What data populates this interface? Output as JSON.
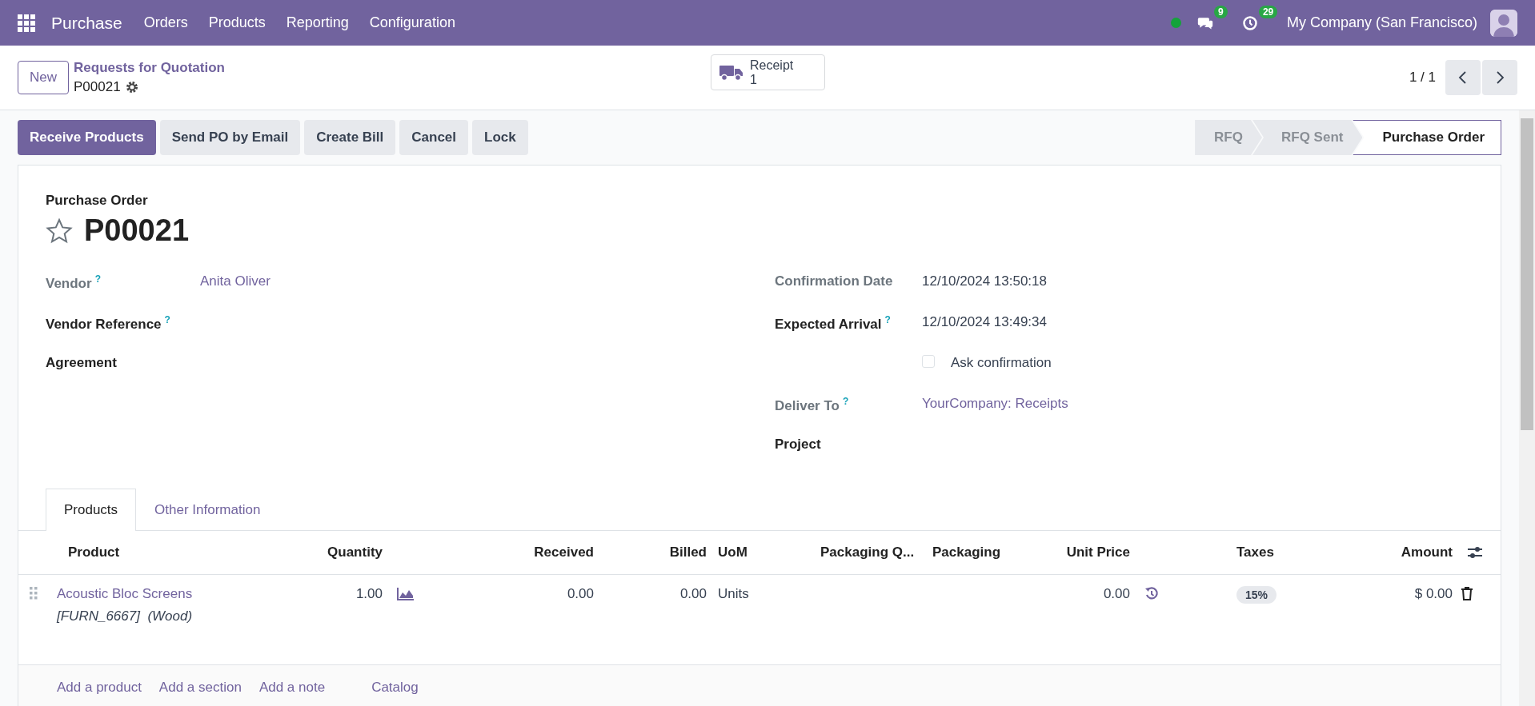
{
  "navbar": {
    "app": "Purchase",
    "menu": [
      "Orders",
      "Products",
      "Reporting",
      "Configuration"
    ],
    "messages_badge": "9",
    "activities_badge": "29",
    "company": "My Company (San Francisco)"
  },
  "control_panel": {
    "new_button": "New",
    "breadcrumb": "Requests for Quotation",
    "record": "P00021",
    "smart_button": {
      "label": "Receipt",
      "count": "1"
    },
    "pager": "1 / 1"
  },
  "actions": [
    {
      "label": "Receive Products",
      "kind": "primary"
    },
    {
      "label": "Send PO by Email",
      "kind": "secondary"
    },
    {
      "label": "Create Bill",
      "kind": "secondary"
    },
    {
      "label": "Cancel",
      "kind": "secondary"
    },
    {
      "label": "Lock",
      "kind": "secondary"
    }
  ],
  "statusbar": [
    {
      "label": "RFQ",
      "selected": false
    },
    {
      "label": "RFQ Sent",
      "selected": false
    },
    {
      "label": "Purchase Order",
      "selected": true
    }
  ],
  "form": {
    "caption": "Purchase Order",
    "title": "P00021",
    "favorite": false,
    "left_fields": [
      {
        "kind": "field",
        "label": "Vendor",
        "readonly": true,
        "help": "?",
        "value": "Anita Oliver",
        "link": true
      },
      {
        "kind": "field",
        "label": "Vendor Reference",
        "readonly": false,
        "help": "?"
      },
      {
        "kind": "field",
        "label": "Agreement",
        "readonly": false
      }
    ],
    "right_fields": [
      {
        "kind": "field",
        "label": "Confirmation Date",
        "readonly": true,
        "value": "12/10/2024 13:50:18",
        "link": false
      },
      {
        "kind": "field",
        "label": "Expected Arrival",
        "readonly": false,
        "help": "?",
        "value": "12/10/2024 13:49:34",
        "link": false
      },
      {
        "kind": "checkbox",
        "label": "Ask confirmation",
        "checked": false
      },
      {
        "kind": "field",
        "label": "Deliver To",
        "readonly": true,
        "help": "?",
        "value": "YourCompany: Receipts",
        "link": true
      },
      {
        "kind": "field",
        "label": "Project",
        "readonly": false
      }
    ]
  },
  "tabs": [
    {
      "label": "Products",
      "selected": true
    },
    {
      "label": "Other Information",
      "selected": false
    }
  ],
  "table": {
    "columns": [
      "Product",
      "Quantity",
      "Received",
      "Billed",
      "UoM",
      "Packaging Q...",
      "Packaging",
      "Unit Price",
      "Taxes",
      "Amount"
    ],
    "rows": [
      {
        "product": "Acoustic Bloc Screens",
        "description": "[FURN_6667]  (Wood)",
        "quantity": "1.00",
        "received": "0.00",
        "billed": "0.00",
        "uom": "Units",
        "unit_price": "0.00",
        "taxes": "15%",
        "amount": "$ 0.00"
      }
    ],
    "add_links": [
      "Add a product",
      "Add a section",
      "Add a note",
      "Catalog"
    ]
  }
}
